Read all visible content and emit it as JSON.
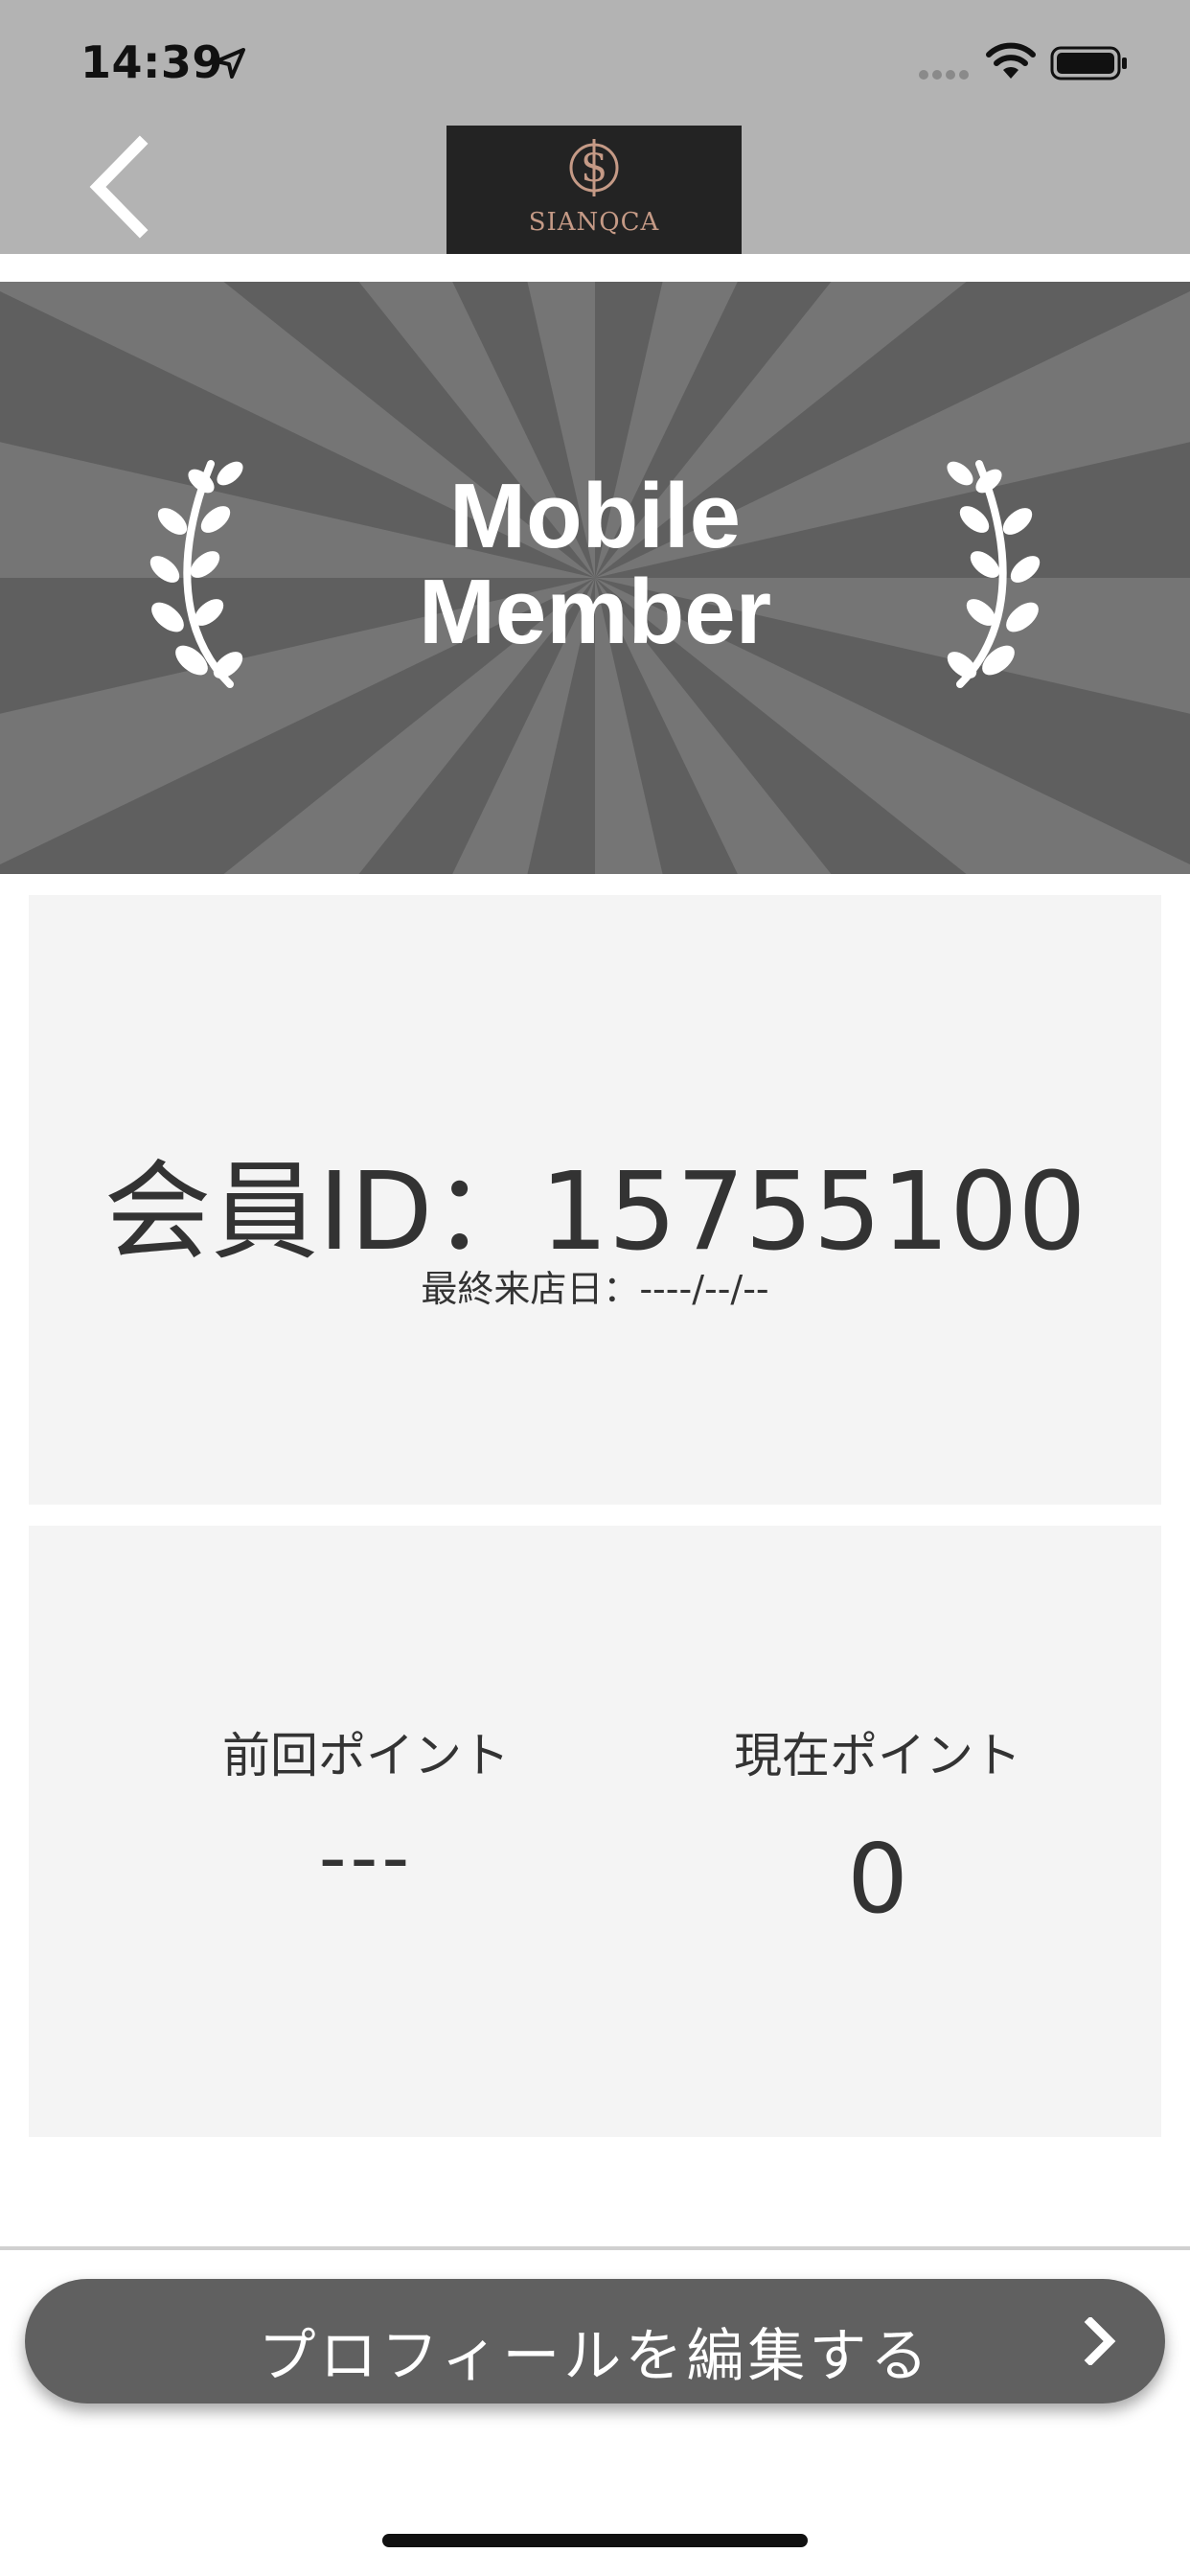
{
  "status_bar": {
    "time": "14:39"
  },
  "header": {
    "logo_text": "SIANQCA"
  },
  "banner": {
    "title_line1": "Mobile",
    "title_line2": "Member"
  },
  "member": {
    "id_text": "会員ID：15755100",
    "last_visit": "最終来店日：----/--/--"
  },
  "points": {
    "previous_label": "前回ポイント",
    "previous_value": "---",
    "current_label": "現在ポイント",
    "current_value": "0"
  },
  "edit_profile": {
    "label": "プロフィールを編集する"
  },
  "colors": {
    "header_bg": "#b3b3b3",
    "banner_dark": "#5f5f5f",
    "banner_light": "#757575",
    "panel_bg": "#f4f4f4",
    "button_bg": "#606060",
    "logo_accent": "#c59a86"
  },
  "icons": {
    "back": "chevron-left-icon",
    "next": "chevron-right-icon",
    "laurel": "laurel-branch-icon",
    "location": "location-arrow-icon",
    "wifi": "wifi-icon",
    "battery": "battery-icon",
    "signal": "cellular-signal-icon"
  }
}
